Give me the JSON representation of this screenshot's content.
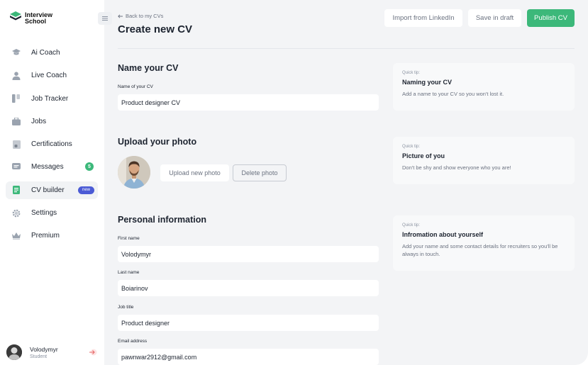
{
  "brand": {
    "line1": "Interview",
    "line2": "School"
  },
  "sidebar": {
    "items": [
      {
        "label": "Ai Coach",
        "icon": "graduation-cap-icon"
      },
      {
        "label": "Live Coach",
        "icon": "person-icon"
      },
      {
        "label": "Job Tracker",
        "icon": "columns-icon"
      },
      {
        "label": "Jobs",
        "icon": "briefcase-icon"
      },
      {
        "label": "Certifications",
        "icon": "certificate-icon"
      },
      {
        "label": "Messages",
        "icon": "message-icon",
        "badge": "5"
      },
      {
        "label": "CV builder",
        "icon": "document-icon",
        "badge": "new",
        "active": true
      },
      {
        "label": "Settings",
        "icon": "gear-icon"
      },
      {
        "label": "Premium",
        "icon": "crown-icon"
      }
    ]
  },
  "user": {
    "name": "Volodymyr",
    "role": "Student"
  },
  "header": {
    "back_label": "Back to my CVs",
    "title": "Create new CV",
    "import_label": "Import from LinkedIn",
    "draft_label": "Save in draft",
    "publish_label": "Publish CV"
  },
  "name_section": {
    "title": "Name your CV",
    "field_label": "Name of your CV",
    "field_value": "Product designer CV"
  },
  "photo_section": {
    "title": "Upload your photo",
    "upload_label": "Upload new photo",
    "delete_label": "Delete photo"
  },
  "personal_section": {
    "title": "Personal information",
    "first_name_label": "First name",
    "first_name_value": "Volodymyr",
    "last_name_label": "Last name",
    "last_name_value": "Boiarinov",
    "job_title_label": "Job title",
    "job_title_value": "Product designer",
    "email_label": "Email address",
    "email_value": "pawnwar2912@gmail.com"
  },
  "tips": [
    {
      "kicker": "Quick tip:",
      "title": "Naming your CV",
      "text": "Add a name to your CV so you won't lost it."
    },
    {
      "kicker": "Quick tip:",
      "title": "Picture of you",
      "text": "Don't be shy and show everyone who you are!"
    },
    {
      "kicker": "Quick tip:",
      "title": "Infromation about yourself",
      "text": "Add your name and some contact details for recruiters so you'll be always in touch."
    }
  ],
  "colors": {
    "accent_green": "#3cb87a",
    "badge_blue": "#4b5bd5",
    "background": "#f3f4f6"
  }
}
